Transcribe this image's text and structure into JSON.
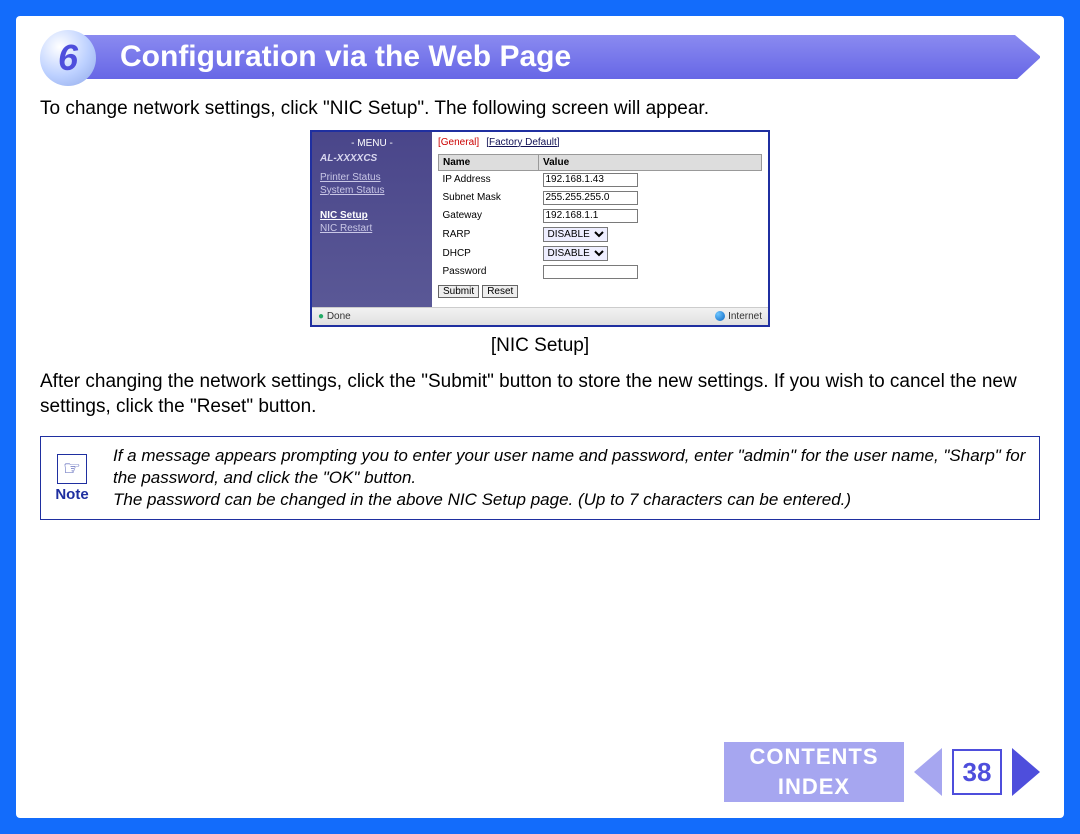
{
  "chapter_number": "6",
  "title": "Configuration via the Web Page",
  "intro": "To change network settings, click \"NIC Setup\". The following screen will appear.",
  "screenshot": {
    "menu_header": "- MENU -",
    "model": "AL-XXXXCS",
    "menu_items": [
      "Printer Status",
      "System Status",
      "NIC Setup",
      "NIC Restart"
    ],
    "active_menu": "NIC Setup",
    "tabs": {
      "active": "[General]",
      "other": "[Factory Default]"
    },
    "columns": {
      "name": "Name",
      "value": "Value"
    },
    "rows": [
      {
        "label": "IP Address",
        "value": "192.168.1.43",
        "type": "text"
      },
      {
        "label": "Subnet Mask",
        "value": "255.255.255.0",
        "type": "text"
      },
      {
        "label": "Gateway",
        "value": "192.168.1.1",
        "type": "text"
      },
      {
        "label": "RARP",
        "value": "DISABLE",
        "type": "select"
      },
      {
        "label": "DHCP",
        "value": "DISABLE",
        "type": "select"
      },
      {
        "label": "Password",
        "value": "",
        "type": "text"
      }
    ],
    "buttons": {
      "submit": "Submit",
      "reset": "Reset"
    },
    "status_left": "Done",
    "status_right": "Internet"
  },
  "caption": "[NIC Setup]",
  "after_text": "After changing the network settings, click the \"Submit\" button to store the new settings. If you wish to cancel the new settings, click the \"Reset\" button.",
  "note": {
    "label": "Note",
    "line1": "If a message appears prompting you to enter your user name and password, enter \"admin\" for the user name, \"Sharp\" for the password, and click the \"OK\" button.",
    "line2": "The password can be changed in the above NIC Setup page. (Up to 7 characters can be entered.)"
  },
  "footer": {
    "contents": "CONTENTS",
    "index": "INDEX",
    "page": "38"
  }
}
